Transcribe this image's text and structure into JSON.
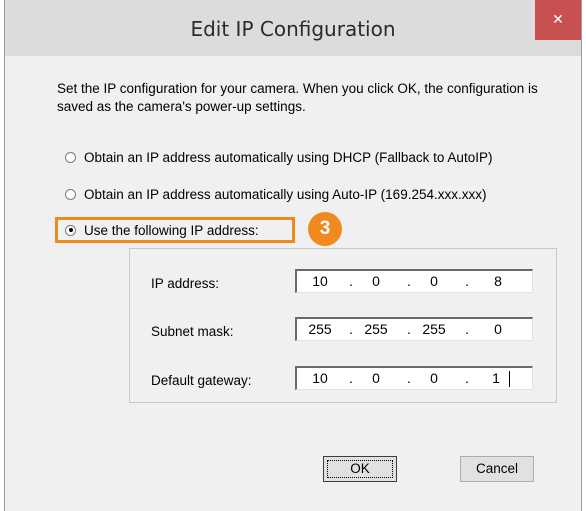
{
  "window": {
    "title": "Edit IP Configuration",
    "close_label": "✕"
  },
  "description": "Set the IP configuration for your camera.  When you click OK, the configuration is saved as the camera's power-up settings.",
  "options": [
    {
      "label": "Obtain an IP address automatically using DHCP (Fallback to AutoIP)",
      "checked": false
    },
    {
      "label": "Obtain an IP address automatically using Auto-IP (169.254.xxx.xxx)",
      "checked": false
    },
    {
      "label": "Use the following IP address:",
      "checked": true
    }
  ],
  "step_badge": "3",
  "fields": {
    "ip": {
      "label": "IP address:",
      "octets": [
        "10",
        "0",
        "0",
        "8"
      ]
    },
    "subnet": {
      "label": "Subnet mask:",
      "octets": [
        "255",
        "255",
        "255",
        "0"
      ]
    },
    "gateway": {
      "label": "Default gateway:",
      "octets": [
        "10",
        "0",
        "0",
        "1"
      ]
    }
  },
  "buttons": {
    "ok": "OK",
    "cancel": "Cancel"
  },
  "colors": {
    "highlight": "#f08a1e",
    "close": "#c75050"
  }
}
